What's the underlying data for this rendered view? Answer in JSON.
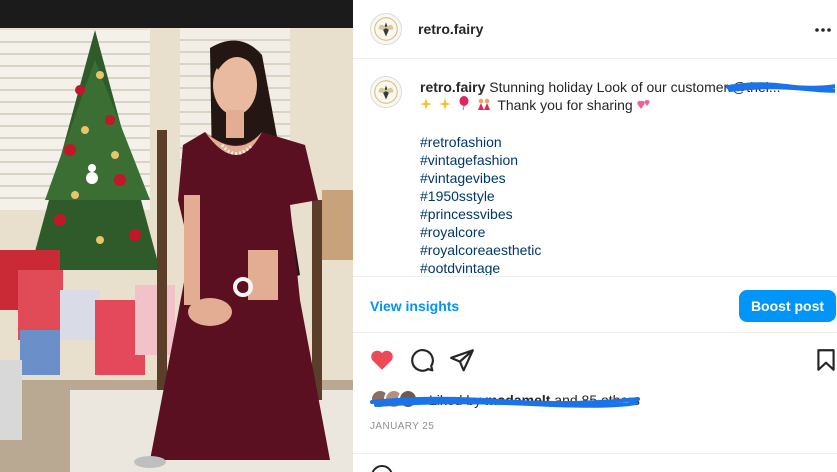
{
  "photo": {
    "alt_subject": "woman in burgundy velvet dress seated beside christmas tree"
  },
  "post": {
    "username": "retro.fairy",
    "caption": {
      "username": "retro.fairy",
      "text": "Stunning holiday Look of our customer",
      "mention": "@thei...",
      "line2_text": "Thank you for sharing",
      "hashtags": [
        "#retrofashion",
        "#vintagefashion",
        "#vintagevibes",
        "#1950sstyle",
        "#princessvibes",
        "#royalcore",
        "#royalcoreaesthetic",
        "#ootdvintage"
      ]
    },
    "view_insights_label": "View insights",
    "boost_label": "Boost post",
    "likes": {
      "prefix": "Liked by",
      "user": "madamelt",
      "suffix": "and 85 others"
    },
    "date": "JANUARY 25"
  },
  "icons": {
    "more": "more-horizontal-icon",
    "like": "heart-filled-icon",
    "comment": "comment-icon",
    "share": "send-icon",
    "save": "bookmark-icon",
    "emoji": "emoji-icon"
  },
  "colors": {
    "accent": "#0095f6",
    "like": "#ed4956",
    "hashtag": "#00376b",
    "scribble": "#1a73e8",
    "dress": "#5a1020"
  }
}
